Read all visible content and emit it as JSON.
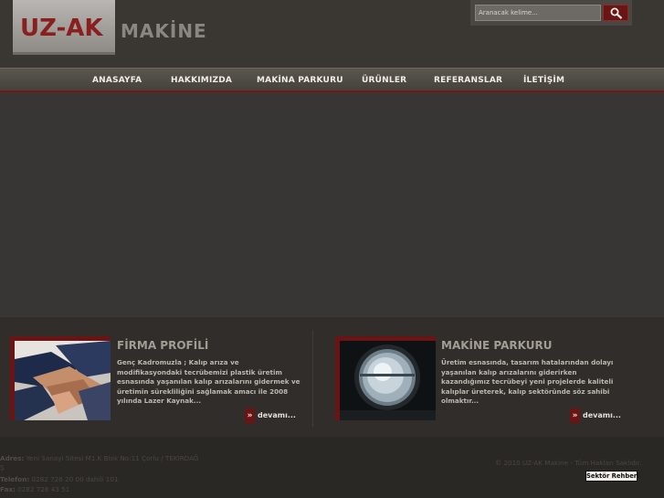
{
  "header": {
    "logo_text": "UZ-AK",
    "logo_sub": "MAKİNE",
    "search_placeholder": "Aranacak kelime..."
  },
  "nav": {
    "items": [
      "ANASAYFA",
      "HAKKIMIZDA",
      "MAKİNA PARKURU",
      "ÜRÜNLER",
      "REFERANSLAR",
      "İLETİŞİM"
    ]
  },
  "features": {
    "left": {
      "title": "FİRMA PROFİLİ",
      "body": "Genç Kadromuzla ; Kalıp arıza ve modifikasyondaki tecrübemizi plastik üretim esnasında yaşanılan kalıp arızalarını gidermek ve üretimin sürekliliğini sağlamak amacı ile 2008 yılında Lazer Kaynak...",
      "more": "devamı..."
    },
    "right": {
      "title": "MAKİNE PARKURU",
      "body": "Üretim esnasında, tasarım hatalarından dolayı yaşanılan kalıp arızalarını giderirken kazandığımız tecrübeyi yeni projelerde kaliteli kalıplar üreterek, kalıp sektöründe söz sahibi olmaktır...",
      "more": "devamı..."
    }
  },
  "footer": {
    "address_label": "Adres:",
    "address": "Yeni Sanayi Sitesi M1.K Blok No:11 Çorlu / TEKİRDAĞ",
    "address_tail": "Ş",
    "phone_label": "Telefon:",
    "phone": "0282 726 20 00 dahili 101",
    "fax_label": "Fax:",
    "fax": "0282 726 43 51",
    "copyright": "© 2010 UZ-AK Makine - Tüm Hakları Saklıdır.",
    "rehber": "Sektör Rehberi"
  },
  "colors": {
    "accent": "#6b1414",
    "background": "#2b2926"
  }
}
